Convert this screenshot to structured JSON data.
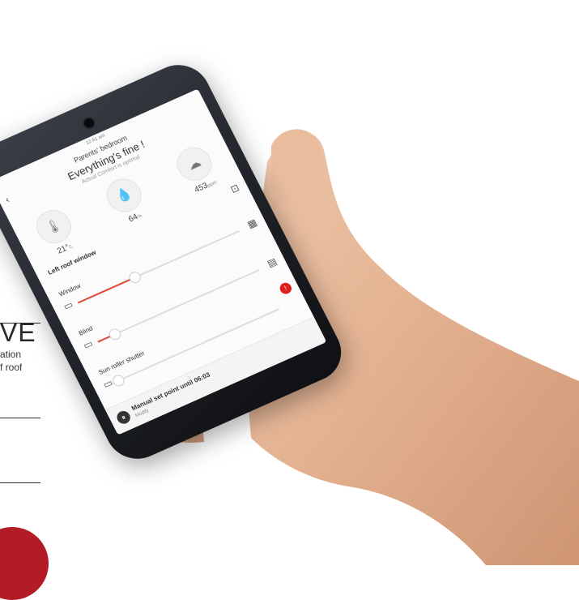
{
  "panel": {
    "headline_fragment": "IVE",
    "description_line1": "ation",
    "description_line2": "f roof"
  },
  "phone": {
    "status_time": "12:41 am",
    "room": "Parents' bedroom",
    "headline": "Everything's fine !",
    "subline": "Actual Comfort is optimal",
    "sensors": [
      {
        "icon": "thermometer-icon",
        "symbol": "🌡",
        "value": "21°",
        "unit": "C"
      },
      {
        "icon": "humidity-icon",
        "symbol": "💧",
        "value": "64",
        "unit": "%"
      },
      {
        "icon": "co2-icon",
        "symbol": "☁",
        "value": "453",
        "unit": "ppm"
      }
    ],
    "section_title": "Left roof window",
    "controls": [
      {
        "label": "Window",
        "level": 0.35
      },
      {
        "label": "Blind",
        "level": 0.1
      },
      {
        "label": "Sun roller shutter",
        "level": 0.0
      }
    ],
    "manual_message": "Manual set point until 06:03",
    "manual_sub": "Modify",
    "accent_color": "#e04a38"
  }
}
